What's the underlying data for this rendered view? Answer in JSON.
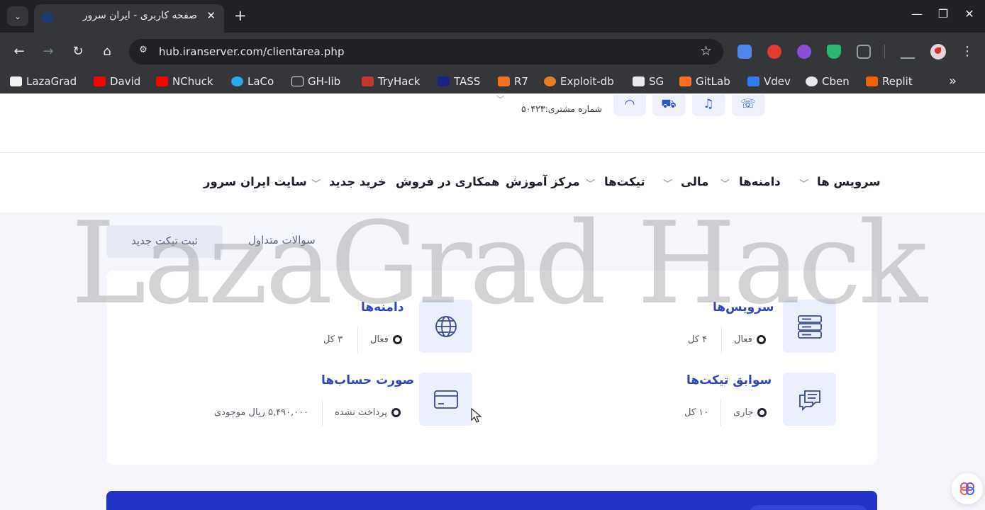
{
  "browser": {
    "tab": {
      "title": "صفحه کاربری - ایران سرور",
      "close_glyph": "✕"
    },
    "new_tab_glyph": "+",
    "tab_search_glyph": "⌄",
    "window_controls": {
      "minimize": "—",
      "restore": "❐",
      "close": "✕"
    },
    "nav": {
      "back": "←",
      "forward": "→",
      "reload": "↻",
      "home": "⌂"
    },
    "url": "hub.iranserver.com/clientarea.php",
    "site_info_glyph": "⚙",
    "star_glyph": "☆",
    "menu_glyph": "⋮",
    "extensions": [
      {
        "name": "translate-extension",
        "color": "#4f86ec"
      },
      {
        "name": "ublock-extension",
        "color": "#e33b2e"
      },
      {
        "name": "colorful-extension",
        "color": "#8a4fd8"
      },
      {
        "name": "shield-extension",
        "color": "#2bb673"
      },
      {
        "name": "extensions-puzzle",
        "color": "#9aa0a6"
      },
      {
        "name": "labs-flask",
        "color": "#9aa0a6"
      }
    ],
    "bookmarks": [
      {
        "label": "LazaGrad",
        "icon": "panda-icon",
        "color": "#f1f1f1"
      },
      {
        "label": "David",
        "icon": "youtube-icon",
        "color": "#ff0000"
      },
      {
        "label": "NChuck",
        "icon": "youtube-icon",
        "color": "#ff0000"
      },
      {
        "label": "LaCo",
        "icon": "telegram-icon",
        "color": "#29a9eb"
      },
      {
        "label": "GH-lib",
        "icon": "folder-icon",
        "color": "transparent"
      },
      {
        "label": "TryHack",
        "icon": "tryhackme-icon",
        "color": "#c0392b"
      },
      {
        "label": "TASS",
        "icon": "tass-icon",
        "color": "#1a237e"
      },
      {
        "label": "R7",
        "icon": "r7-icon",
        "color": "#f36f21"
      },
      {
        "label": "Exploit-db",
        "icon": "exploitdb-icon",
        "color": "#e67e22"
      },
      {
        "label": "SG",
        "icon": "sg-icon",
        "color": "#e8eaed"
      },
      {
        "label": "GitLab",
        "icon": "gitlab-icon",
        "color": "#fc6d26"
      },
      {
        "label": "Vdev",
        "icon": "vscode-icon",
        "color": "#2f80ed"
      },
      {
        "label": "Cben",
        "icon": "cben-icon",
        "color": "#e8eaed"
      },
      {
        "label": "Replit",
        "icon": "replit-icon",
        "color": "#f26207"
      }
    ],
    "more_bookmarks_glyph": "»"
  },
  "header": {
    "customer_number": "شماره مشتری:۵۰۴۲۳",
    "icons": [
      "phone-icon",
      "bell-icon",
      "cart-icon",
      "user-icon"
    ]
  },
  "nav": {
    "items": [
      {
        "label": "سرویس ها",
        "has_dropdown": true
      },
      {
        "label": "دامنه‌ها",
        "has_dropdown": true
      },
      {
        "label": "مالی",
        "has_dropdown": true
      },
      {
        "label": "تیکت‌ها",
        "has_dropdown": true
      },
      {
        "label": "مرکز آموزش",
        "has_dropdown": false
      },
      {
        "label": "همکاری در فروش",
        "has_dropdown": false
      },
      {
        "label": "خرید جدید",
        "has_dropdown": true
      },
      {
        "label": "سایت ایران سرور",
        "has_dropdown": false
      }
    ]
  },
  "actions": {
    "new_ticket": "ثبت تیکت جدید",
    "faq": "سوالات متداول"
  },
  "tiles": {
    "services": {
      "title": "سرویس‌ها",
      "status_label": "فعال",
      "total": "۴ کل",
      "icon": "server-icon"
    },
    "domains": {
      "title": "دامنه‌ها",
      "status_label": "فعال",
      "total": "۳ کل",
      "icon": "globe-icon"
    },
    "tickets": {
      "title": "سوابق تیکت‌ها",
      "status_label": "جاری",
      "total": "۱۰ کل",
      "icon": "chat-icon"
    },
    "invoices": {
      "title": "صورت حساب‌ها",
      "status_label": "پرداخت نشده",
      "total": "۵,۴۹۰,۰۰۰ ریال موجودی",
      "icon": "card-icon"
    }
  },
  "watermark": "LazaGrad Hack",
  "colors": {
    "accent": "#2f46b4",
    "banner": "#2134c7",
    "tile_bg": "#eaeefd"
  }
}
